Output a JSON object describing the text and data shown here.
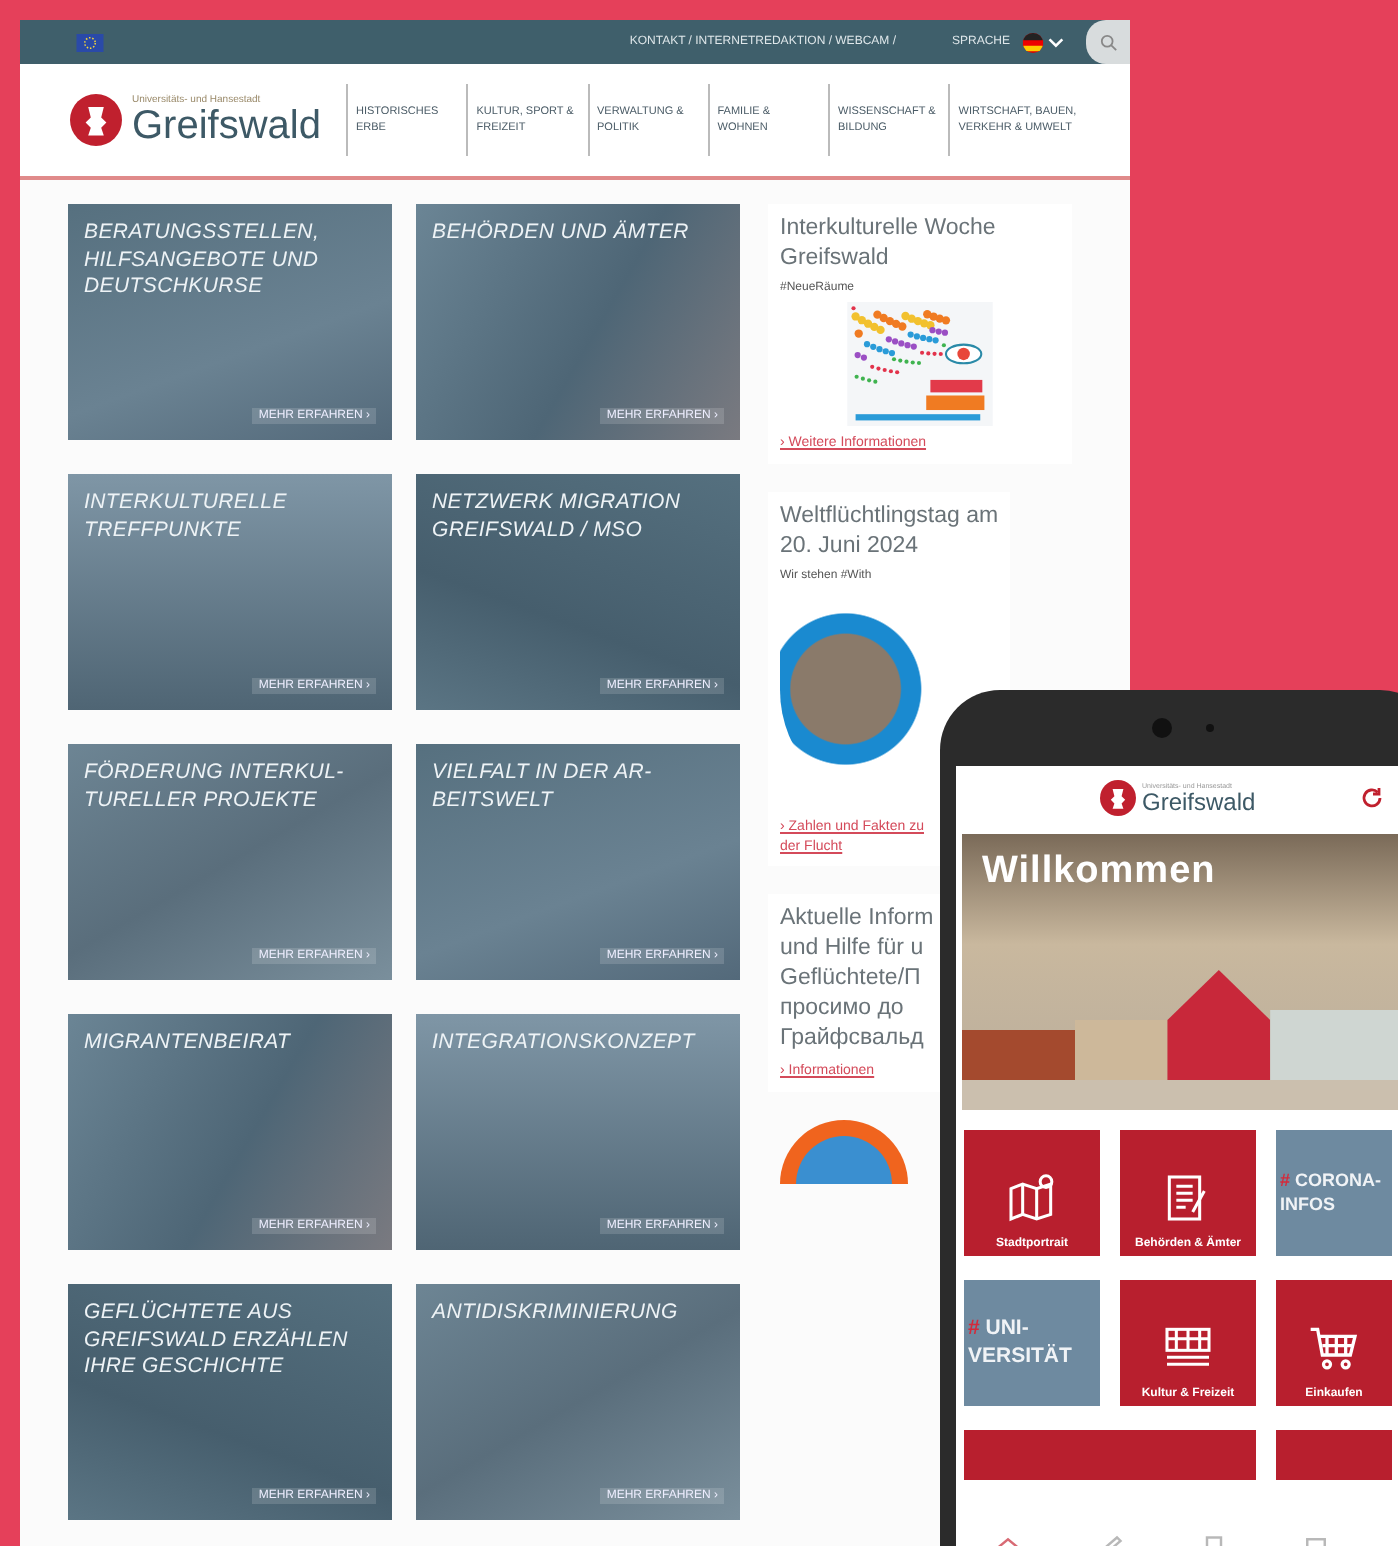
{
  "top_bar": {
    "links": "KONTAKT / INTERNETREDAKTION / WEBCAM /",
    "language_label": "SPRACHE"
  },
  "header": {
    "logo_subtitle": "Universitäts- und Hansestadt",
    "logo_title": "Greifswald",
    "nav": [
      {
        "label": "HISTORISCHES ERBE"
      },
      {
        "label": "KULTUR, SPORT & FREIZEIT"
      },
      {
        "label": "VERWALTUNG & POLITIK"
      },
      {
        "label": "FAMILIE & WOHNEN"
      },
      {
        "label": "WISSENSCHAFT & BILDUNG"
      },
      {
        "label": "WIRTSCHAFT, BAUEN, VERKEHR & UMWELT"
      }
    ]
  },
  "tiles": [
    {
      "title": "BERATUNGSSTELLEN, HILFSANGEBOTE UND DEUTSCHKURSE",
      "link": "MEHR ERFAHREN ›"
    },
    {
      "title": "BEHÖRDEN UND ÄMTER",
      "link": "MEHR ERFAHREN ›"
    },
    {
      "title": "INTERKULTURELLE TREFFPUNKTE",
      "link": "MEHR ERFAHREN ›"
    },
    {
      "title": "NETZWERK MIGRATION GREIFSWALD / MSO",
      "link": "MEHR ERFAHREN ›"
    },
    {
      "title": "FÖRDERUNG INTERKUL-TURELLER PROJEKTE",
      "link": "MEHR ERFAHREN ›"
    },
    {
      "title": "VIELFALT IN DER AR-BEITSWELT",
      "link": "MEHR ERFAHREN ›"
    },
    {
      "title": "MIGRANTENBEIRAT",
      "link": "MEHR ERFAHREN ›"
    },
    {
      "title": "INTEGRATIONSKONZEPT",
      "link": "MEHR ERFAHREN ›"
    },
    {
      "title": "GEFLÜCHTETE AUS GREIFSWALD ERZÄHLEN IHRE GESCHICHTE",
      "link": "MEHR ERFAHREN ›"
    },
    {
      "title": "ANTIDISKRIMINIERUNG",
      "link": "MEHR ERFAHREN ›"
    }
  ],
  "sidebar": [
    {
      "kind": "poster",
      "title_lines": [
        "Interkulturelle Woche",
        "Greifswald"
      ],
      "subtitle": "#NeueRäume",
      "link": "› Weitere Informationen"
    },
    {
      "kind": "photo",
      "title_lines": [
        "Weltflüchtlingstag am",
        "20. Juni 2024"
      ],
      "subtitle": "Wir stehen #With",
      "link": "› Zahlen und Fakten zu der Flucht"
    },
    {
      "kind": "text",
      "title_lines": [
        "Aktuelle Inform",
        "und Hilfe für u",
        "Geflüchtete/П",
        "просимо до",
        "Грайфсвальд"
      ],
      "link": "› Informationen"
    },
    {
      "kind": "graphic"
    }
  ],
  "phone": {
    "logo_subtitle": "Universitäts- und Hansestadt",
    "logo_title": "Greifswald",
    "banner_title": "Willkommen",
    "tiles": [
      {
        "kind": "icon",
        "label": "Stadtportrait"
      },
      {
        "kind": "icon",
        "label": "Behörden & Ämter"
      },
      {
        "kind": "hashtag",
        "hash": "#",
        "label": "CORONA-INFOS"
      },
      {
        "kind": "hashtag",
        "hash": "#",
        "label": "UNI-VERSITÄT"
      },
      {
        "kind": "icon",
        "label": "Kultur & Freizeit"
      },
      {
        "kind": "icon",
        "label": "Einkaufen"
      },
      {
        "kind": "wide"
      },
      {
        "kind": "icon"
      }
    ],
    "nav": [
      {
        "selected": true
      },
      {
        "selected": false
      },
      {
        "selected": false
      },
      {
        "selected": false
      }
    ]
  }
}
